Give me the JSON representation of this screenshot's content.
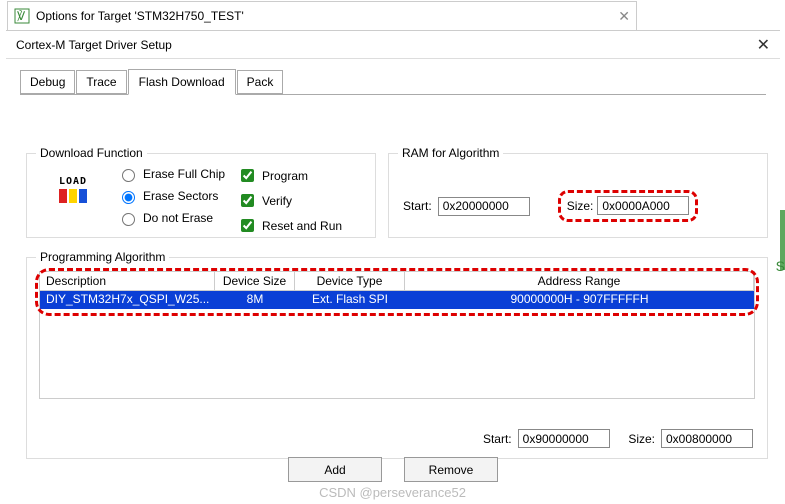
{
  "behind": {
    "title": "Options for Target 'STM32H750_TEST'"
  },
  "main": {
    "title": "Cortex-M Target Driver Setup",
    "tabs": [
      "Debug",
      "Trace",
      "Flash Download",
      "Pack"
    ],
    "active_tab": "Flash Download"
  },
  "download_function": {
    "legend": "Download Function",
    "icon_label": "LOAD",
    "radios": {
      "erase_full": "Erase Full Chip",
      "erase_sectors": "Erase Sectors",
      "do_not_erase": "Do not Erase",
      "selected": "erase_sectors"
    },
    "checks": {
      "program": "Program",
      "verify": "Verify",
      "reset_and_run": "Reset and Run"
    }
  },
  "ram": {
    "legend": "RAM for Algorithm",
    "start_label": "Start:",
    "start": "0x20000000",
    "size_label": "Size:",
    "size": "0x0000A000"
  },
  "prog_alg": {
    "legend": "Programming Algorithm",
    "headers": {
      "desc": "Description",
      "dsize": "Device Size",
      "dtype": "Device Type",
      "range": "Address Range"
    },
    "rows": [
      {
        "desc": "DIY_STM32H7x_QSPI_W25...",
        "dsize": "8M",
        "dtype": "Ext. Flash SPI",
        "range": "90000000H - 907FFFFFH"
      }
    ],
    "bottom": {
      "start_label": "Start:",
      "start": "0x90000000",
      "size_label": "Size:",
      "size": "0x00800000"
    },
    "buttons": {
      "add": "Add",
      "remove": "Remove"
    }
  },
  "watermark": "CSDN @perseverance52",
  "close_glyph": "✕"
}
